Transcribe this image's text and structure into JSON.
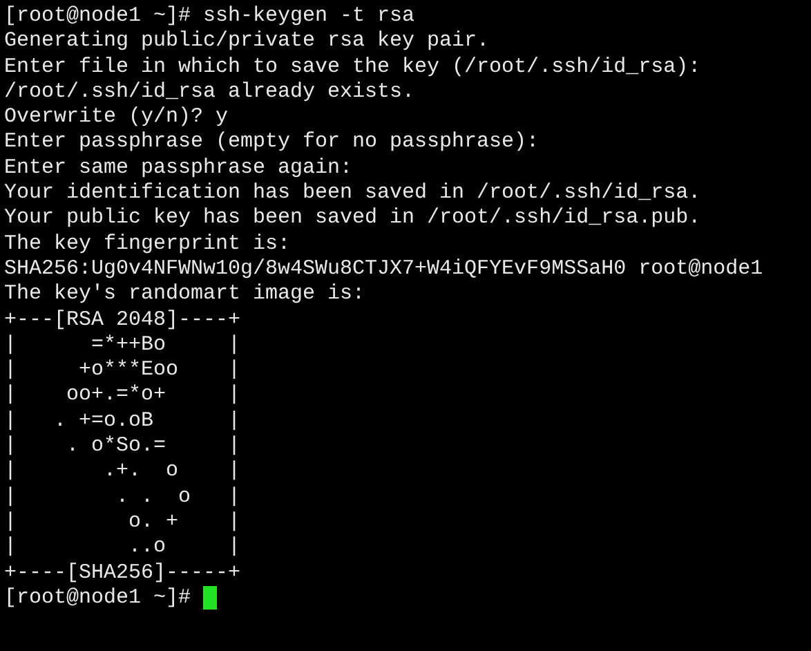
{
  "terminal": {
    "lines": [
      "[root@node1 ~]# ssh-keygen -t rsa",
      "Generating public/private rsa key pair.",
      "Enter file in which to save the key (/root/.ssh/id_rsa):",
      "/root/.ssh/id_rsa already exists.",
      "Overwrite (y/n)? y",
      "Enter passphrase (empty for no passphrase):",
      "Enter same passphrase again:",
      "Your identification has been saved in /root/.ssh/id_rsa.",
      "Your public key has been saved in /root/.ssh/id_rsa.pub.",
      "The key fingerprint is:",
      "SHA256:Ug0v4NFWNw10g/8w4SWu8CTJX7+W4iQFYEvF9MSSaH0 root@node1",
      "The key's randomart image is:",
      "+---[RSA 2048]----+",
      "|      =*++Bo     |",
      "|     +o***Eoo    |",
      "|    oo+.=*o+     |",
      "|   . +=o.oB      |",
      "|    . o*So.=     |",
      "|       .+.  o    |",
      "|        . .  o   |",
      "|         o. +    |",
      "|         ..o     |",
      "+----[SHA256]-----+"
    ],
    "prompt": "[root@node1 ~]#",
    "cursor_visible": true
  }
}
